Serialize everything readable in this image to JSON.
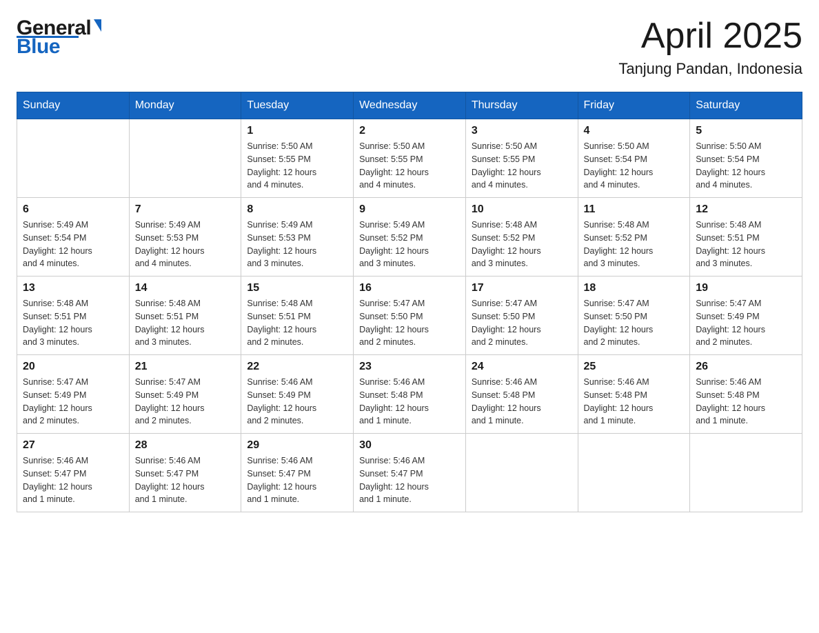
{
  "logo": {
    "general": "General",
    "blue": "Blue"
  },
  "header": {
    "month": "April 2025",
    "location": "Tanjung Pandan, Indonesia"
  },
  "days_of_week": [
    "Sunday",
    "Monday",
    "Tuesday",
    "Wednesday",
    "Thursday",
    "Friday",
    "Saturday"
  ],
  "weeks": [
    [
      {
        "day": "",
        "info": ""
      },
      {
        "day": "",
        "info": ""
      },
      {
        "day": "1",
        "info": "Sunrise: 5:50 AM\nSunset: 5:55 PM\nDaylight: 12 hours\nand 4 minutes."
      },
      {
        "day": "2",
        "info": "Sunrise: 5:50 AM\nSunset: 5:55 PM\nDaylight: 12 hours\nand 4 minutes."
      },
      {
        "day": "3",
        "info": "Sunrise: 5:50 AM\nSunset: 5:55 PM\nDaylight: 12 hours\nand 4 minutes."
      },
      {
        "day": "4",
        "info": "Sunrise: 5:50 AM\nSunset: 5:54 PM\nDaylight: 12 hours\nand 4 minutes."
      },
      {
        "day": "5",
        "info": "Sunrise: 5:50 AM\nSunset: 5:54 PM\nDaylight: 12 hours\nand 4 minutes."
      }
    ],
    [
      {
        "day": "6",
        "info": "Sunrise: 5:49 AM\nSunset: 5:54 PM\nDaylight: 12 hours\nand 4 minutes."
      },
      {
        "day": "7",
        "info": "Sunrise: 5:49 AM\nSunset: 5:53 PM\nDaylight: 12 hours\nand 4 minutes."
      },
      {
        "day": "8",
        "info": "Sunrise: 5:49 AM\nSunset: 5:53 PM\nDaylight: 12 hours\nand 3 minutes."
      },
      {
        "day": "9",
        "info": "Sunrise: 5:49 AM\nSunset: 5:52 PM\nDaylight: 12 hours\nand 3 minutes."
      },
      {
        "day": "10",
        "info": "Sunrise: 5:48 AM\nSunset: 5:52 PM\nDaylight: 12 hours\nand 3 minutes."
      },
      {
        "day": "11",
        "info": "Sunrise: 5:48 AM\nSunset: 5:52 PM\nDaylight: 12 hours\nand 3 minutes."
      },
      {
        "day": "12",
        "info": "Sunrise: 5:48 AM\nSunset: 5:51 PM\nDaylight: 12 hours\nand 3 minutes."
      }
    ],
    [
      {
        "day": "13",
        "info": "Sunrise: 5:48 AM\nSunset: 5:51 PM\nDaylight: 12 hours\nand 3 minutes."
      },
      {
        "day": "14",
        "info": "Sunrise: 5:48 AM\nSunset: 5:51 PM\nDaylight: 12 hours\nand 3 minutes."
      },
      {
        "day": "15",
        "info": "Sunrise: 5:48 AM\nSunset: 5:51 PM\nDaylight: 12 hours\nand 2 minutes."
      },
      {
        "day": "16",
        "info": "Sunrise: 5:47 AM\nSunset: 5:50 PM\nDaylight: 12 hours\nand 2 minutes."
      },
      {
        "day": "17",
        "info": "Sunrise: 5:47 AM\nSunset: 5:50 PM\nDaylight: 12 hours\nand 2 minutes."
      },
      {
        "day": "18",
        "info": "Sunrise: 5:47 AM\nSunset: 5:50 PM\nDaylight: 12 hours\nand 2 minutes."
      },
      {
        "day": "19",
        "info": "Sunrise: 5:47 AM\nSunset: 5:49 PM\nDaylight: 12 hours\nand 2 minutes."
      }
    ],
    [
      {
        "day": "20",
        "info": "Sunrise: 5:47 AM\nSunset: 5:49 PM\nDaylight: 12 hours\nand 2 minutes."
      },
      {
        "day": "21",
        "info": "Sunrise: 5:47 AM\nSunset: 5:49 PM\nDaylight: 12 hours\nand 2 minutes."
      },
      {
        "day": "22",
        "info": "Sunrise: 5:46 AM\nSunset: 5:49 PM\nDaylight: 12 hours\nand 2 minutes."
      },
      {
        "day": "23",
        "info": "Sunrise: 5:46 AM\nSunset: 5:48 PM\nDaylight: 12 hours\nand 1 minute."
      },
      {
        "day": "24",
        "info": "Sunrise: 5:46 AM\nSunset: 5:48 PM\nDaylight: 12 hours\nand 1 minute."
      },
      {
        "day": "25",
        "info": "Sunrise: 5:46 AM\nSunset: 5:48 PM\nDaylight: 12 hours\nand 1 minute."
      },
      {
        "day": "26",
        "info": "Sunrise: 5:46 AM\nSunset: 5:48 PM\nDaylight: 12 hours\nand 1 minute."
      }
    ],
    [
      {
        "day": "27",
        "info": "Sunrise: 5:46 AM\nSunset: 5:47 PM\nDaylight: 12 hours\nand 1 minute."
      },
      {
        "day": "28",
        "info": "Sunrise: 5:46 AM\nSunset: 5:47 PM\nDaylight: 12 hours\nand 1 minute."
      },
      {
        "day": "29",
        "info": "Sunrise: 5:46 AM\nSunset: 5:47 PM\nDaylight: 12 hours\nand 1 minute."
      },
      {
        "day": "30",
        "info": "Sunrise: 5:46 AM\nSunset: 5:47 PM\nDaylight: 12 hours\nand 1 minute."
      },
      {
        "day": "",
        "info": ""
      },
      {
        "day": "",
        "info": ""
      },
      {
        "day": "",
        "info": ""
      }
    ]
  ]
}
